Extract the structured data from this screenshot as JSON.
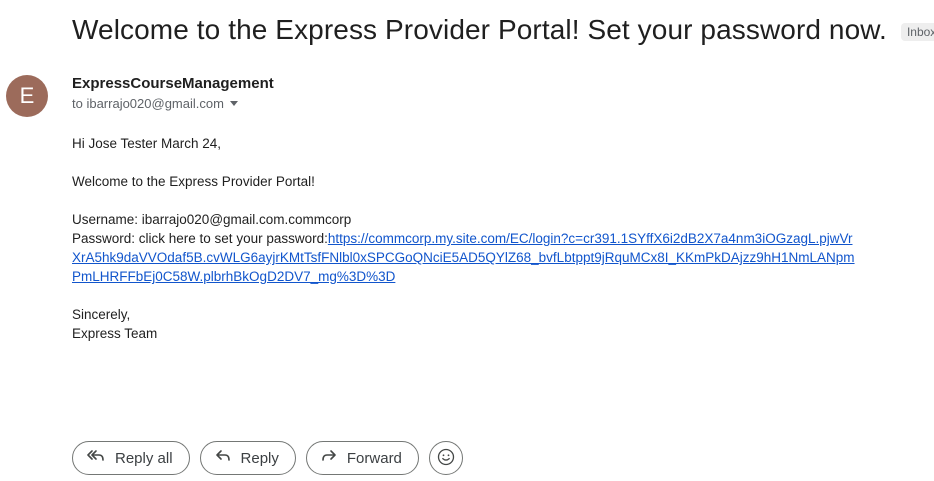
{
  "email": {
    "subject": "Welcome to the Express Provider Portal! Set your password now.",
    "label_chip": "Inbox",
    "label_chip_close": "×",
    "avatar_letter": "E",
    "sender_name": "ExpressCourseManagement",
    "recipient": "to ibarrajo020@gmail.com",
    "body": {
      "greeting": "Hi Jose Tester March 24,",
      "welcome": "Welcome to the Express Provider Portal!",
      "username_line": "Username: ibarrajo020@gmail.com.commcorp",
      "password_prefix": "Password: click here to set your password:",
      "password_link_line1": "https://commcorp.my.site.com/EC/login?c=cr391.1SYffX6i2dB2X7a4nm3iOGzagL.pjwVr",
      "password_link_line2": "XrA5hk9daVVOdaf5B.cvWLG6ayjrKMtTsfFNlbl0xSPCGoQNciE5AD5QYlZ68_bvfLbtppt9jRquMCx8I_KKmPkDAjzz9hH1NmLANpm",
      "password_link_line3": "PmLHRFFbEj0C58W.plbrhBkOgD2DV7_mg%3D%3D",
      "signoff": "Sincerely,",
      "signature": "Express Team"
    }
  },
  "actions": {
    "reply_all_label": "Reply all",
    "reply_label": "Reply",
    "forward_label": "Forward",
    "reply_all_icon": "reply-all-icon",
    "reply_icon": "reply-icon",
    "forward_icon": "forward-icon",
    "emoji_icon": "emoji-reaction-icon"
  },
  "colors": {
    "avatar_bg": "#9c6b5b",
    "link": "#1155cc",
    "chip_bg": "#eeeeee"
  }
}
